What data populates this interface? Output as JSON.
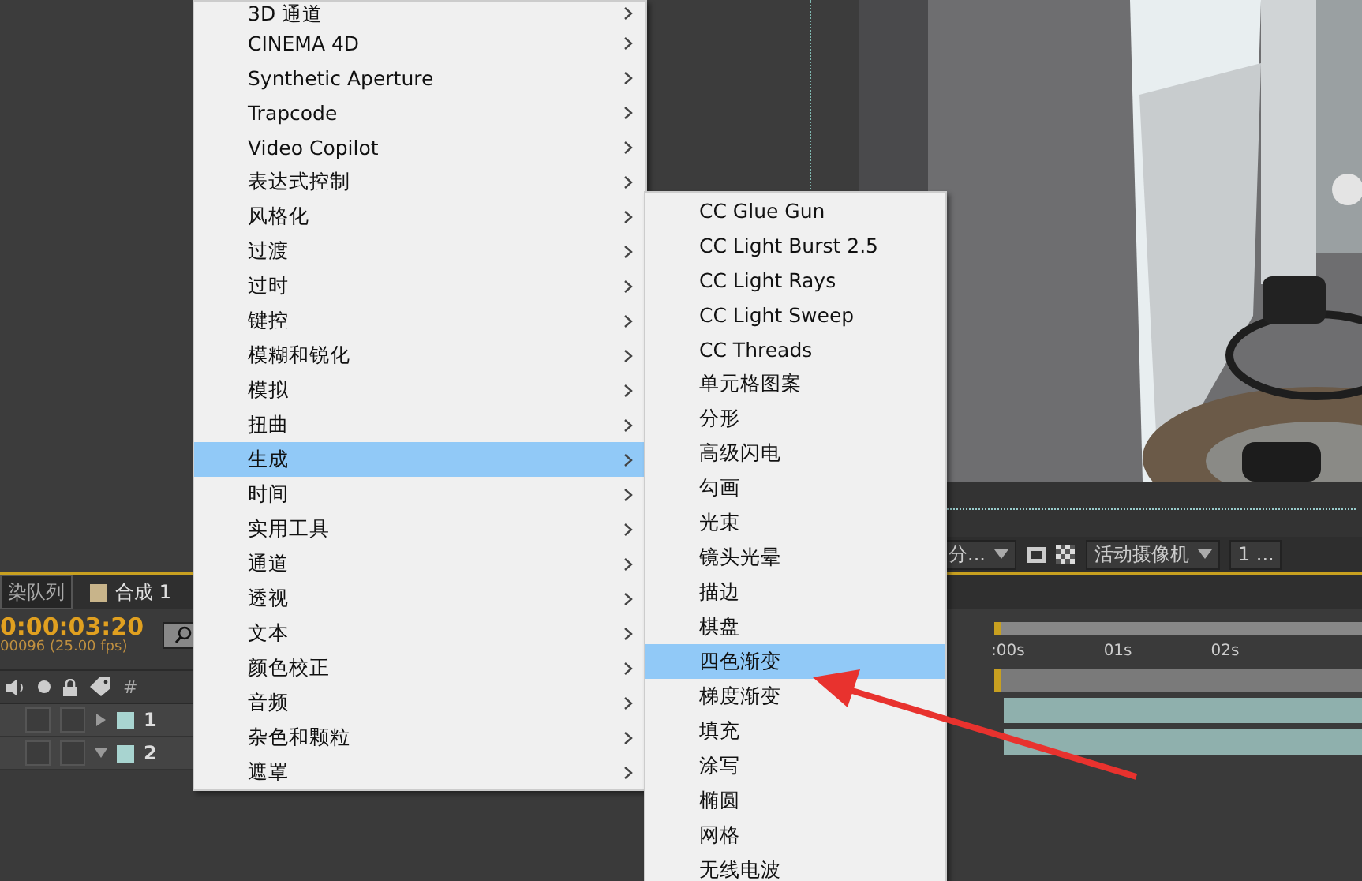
{
  "menu": {
    "items": [
      {
        "label": "3D 通道",
        "has_submenu": true,
        "selected": false
      },
      {
        "label": "CINEMA 4D",
        "has_submenu": true,
        "selected": false
      },
      {
        "label": "Synthetic Aperture",
        "has_submenu": true,
        "selected": false
      },
      {
        "label": "Trapcode",
        "has_submenu": true,
        "selected": false
      },
      {
        "label": "Video Copilot",
        "has_submenu": true,
        "selected": false
      },
      {
        "label": "表达式控制",
        "has_submenu": true,
        "selected": false
      },
      {
        "label": "风格化",
        "has_submenu": true,
        "selected": false
      },
      {
        "label": "过渡",
        "has_submenu": true,
        "selected": false
      },
      {
        "label": "过时",
        "has_submenu": true,
        "selected": false
      },
      {
        "label": "键控",
        "has_submenu": true,
        "selected": false
      },
      {
        "label": "模糊和锐化",
        "has_submenu": true,
        "selected": false
      },
      {
        "label": "模拟",
        "has_submenu": true,
        "selected": false
      },
      {
        "label": "扭曲",
        "has_submenu": true,
        "selected": false
      },
      {
        "label": "生成",
        "has_submenu": true,
        "selected": true
      },
      {
        "label": "时间",
        "has_submenu": true,
        "selected": false
      },
      {
        "label": "实用工具",
        "has_submenu": true,
        "selected": false
      },
      {
        "label": "通道",
        "has_submenu": true,
        "selected": false
      },
      {
        "label": "透视",
        "has_submenu": true,
        "selected": false
      },
      {
        "label": "文本",
        "has_submenu": true,
        "selected": false
      },
      {
        "label": "颜色校正",
        "has_submenu": true,
        "selected": false
      },
      {
        "label": "音频",
        "has_submenu": true,
        "selected": false
      },
      {
        "label": "杂色和颗粒",
        "has_submenu": true,
        "selected": false
      },
      {
        "label": "遮罩",
        "has_submenu": true,
        "selected": false
      }
    ]
  },
  "submenu": {
    "items": [
      {
        "label": "CC Glue Gun",
        "selected": false
      },
      {
        "label": "CC Light Burst 2.5",
        "selected": false
      },
      {
        "label": "CC Light Rays",
        "selected": false
      },
      {
        "label": "CC Light Sweep",
        "selected": false
      },
      {
        "label": "CC Threads",
        "selected": false
      },
      {
        "label": "单元格图案",
        "selected": false
      },
      {
        "label": "分形",
        "selected": false
      },
      {
        "label": "高级闪电",
        "selected": false
      },
      {
        "label": "勾画",
        "selected": false
      },
      {
        "label": "光束",
        "selected": false
      },
      {
        "label": "镜头光晕",
        "selected": false
      },
      {
        "label": "描边",
        "selected": false
      },
      {
        "label": "棋盘",
        "selected": false
      },
      {
        "label": "四色渐变",
        "selected": true
      },
      {
        "label": "梯度渐变",
        "selected": false
      },
      {
        "label": "填充",
        "selected": false
      },
      {
        "label": "涂写",
        "selected": false
      },
      {
        "label": "椭圆",
        "selected": false
      },
      {
        "label": "网格",
        "selected": false
      },
      {
        "label": "无线电波",
        "selected": false
      }
    ]
  },
  "viewer": {
    "toolbar": {
      "resolution": "分...",
      "camera": "活动摄像机",
      "views": "1 ..."
    }
  },
  "timeline": {
    "tabs": [
      {
        "label": "染队列",
        "kind": "queue",
        "selected": false
      },
      {
        "label": "合成 1",
        "kind": "composition",
        "selected": true
      }
    ],
    "timecode": "0:00:03:20",
    "frame": "00096 (25.00 fps)",
    "number_header": "#",
    "layers": [
      {
        "number": "1",
        "expanded": false
      },
      {
        "number": "2",
        "expanded": true
      }
    ],
    "ruler": [
      ":00s",
      "01s",
      "02s"
    ]
  }
}
